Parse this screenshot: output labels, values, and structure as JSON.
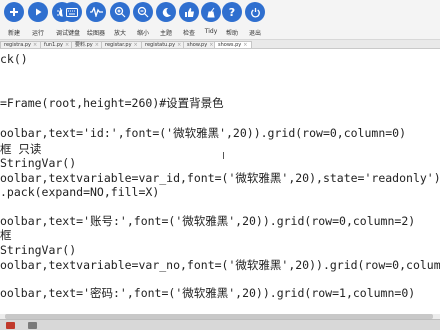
{
  "toolbar": {
    "items": [
      {
        "name": "new-file",
        "icon": "plus-icon",
        "label": "新建"
      },
      {
        "name": "run",
        "icon": "play-icon",
        "label": "运行"
      },
      {
        "name": "debug",
        "icon": "bug-icon",
        "label": "调试"
      },
      {
        "name": "keyboard",
        "icon": "keyboard-icon",
        "label": "键盘"
      },
      {
        "name": "plotter",
        "icon": "wave-icon",
        "label": "绘图器"
      },
      {
        "name": "zoom-in",
        "icon": "zoom-in-icon",
        "label": "放大"
      },
      {
        "name": "zoom-out",
        "icon": "zoom-out-icon",
        "label": "缩小"
      },
      {
        "name": "theme",
        "icon": "moon-icon",
        "label": "主题"
      },
      {
        "name": "check",
        "icon": "thumbs-up-icon",
        "label": "检查"
      },
      {
        "name": "tidy",
        "icon": "broom-icon",
        "label": "Tidy"
      },
      {
        "name": "help",
        "icon": "help-icon",
        "label": "帮助"
      },
      {
        "name": "quit",
        "icon": "power-icon",
        "label": "退出"
      }
    ],
    "accent": "#2f6fcf"
  },
  "tabs": [
    {
      "label": "registra.py",
      "active": false
    },
    {
      "label": "fun1.py",
      "active": false
    },
    {
      "label": "要料.py",
      "active": false
    },
    {
      "label": "registar.py",
      "active": false
    },
    {
      "label": "registatu.py",
      "active": false
    },
    {
      "label": "show.py",
      "active": false
    },
    {
      "label": "shows.py",
      "active": true
    }
  ],
  "code_lines": [
    {
      "text": "ck()"
    },
    {
      "text": ""
    },
    {
      "text": ""
    },
    {
      "text": "=Frame(root,height=260)#设置背景色"
    },
    {
      "text": ""
    },
    {
      "text": "oolbar,text='id:',font=('微软雅黑',20)).grid(row=0,column=0)"
    },
    {
      "text": "框 只读"
    },
    {
      "text": "StringVar()"
    },
    {
      "text": "oolbar,textvariable=var_id,font=('微软雅黑',20),state='readonly').g"
    },
    {
      "text": ".pack(expand=NO,fill=X)"
    },
    {
      "text": ""
    },
    {
      "text": "oolbar,text='账号:',font=('微软雅黑',20)).grid(row=0,column=2)"
    },
    {
      "text": "框"
    },
    {
      "text": "StringVar()"
    },
    {
      "text": "oolbar,textvariable=var_no,font=('微软雅黑',20)).grid(row=0,column="
    },
    {
      "text": ""
    },
    {
      "text": "oolbar,text='密码:',font=('微软雅黑',20)).grid(row=1,column=0)"
    }
  ]
}
